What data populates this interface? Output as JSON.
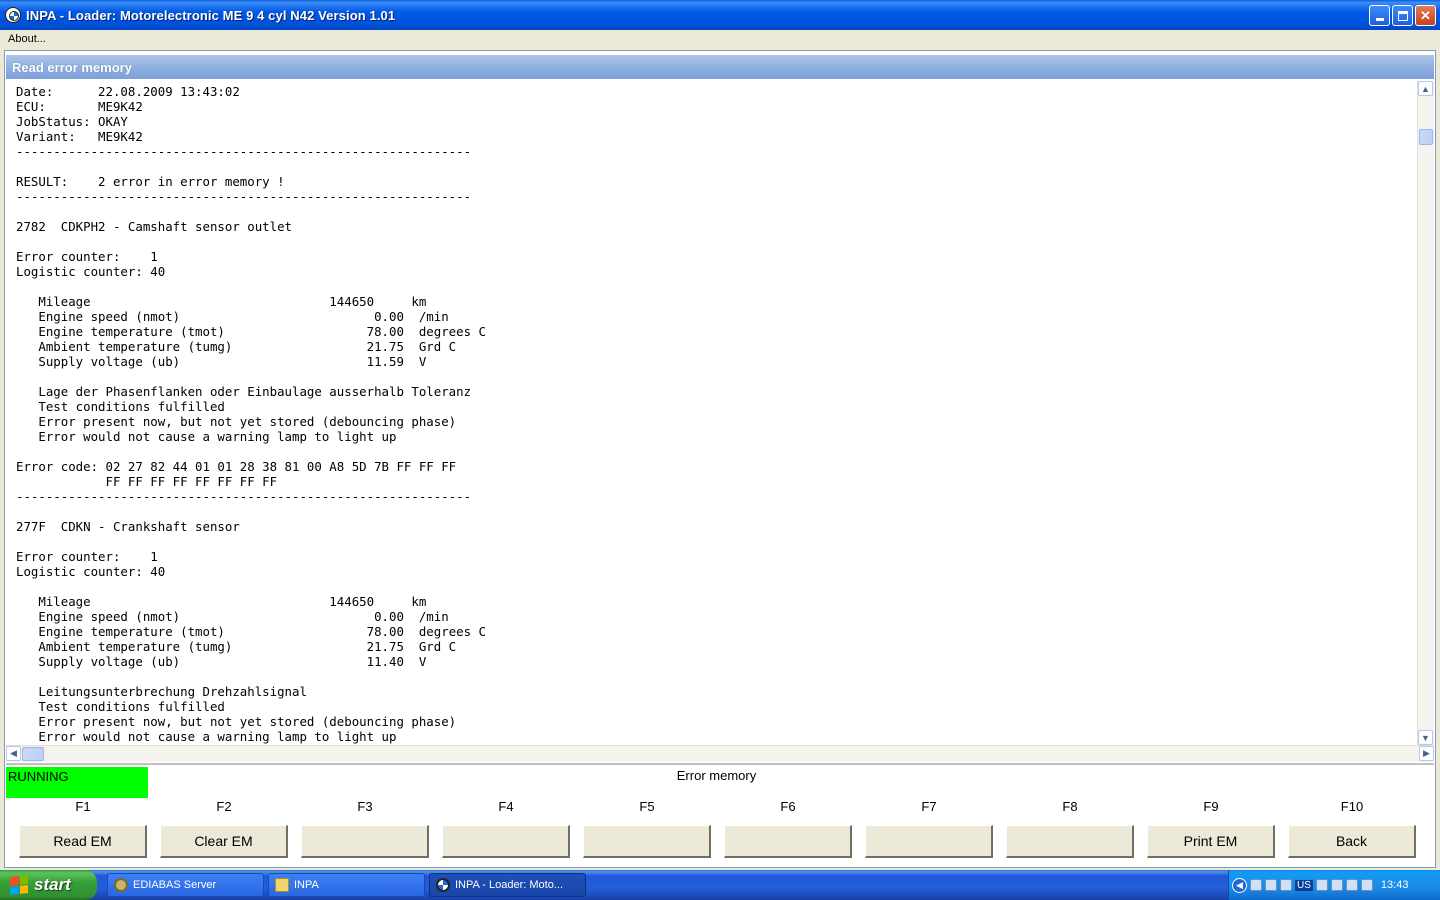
{
  "window": {
    "title": "INPA - Loader:  Motorelectronic ME 9  4 cyl N42 Version 1.01"
  },
  "menu": {
    "about": "About..."
  },
  "panel": {
    "title": "Read error memory",
    "report_lines": [
      "Date:      22.08.2009 13:43:02",
      "ECU:       ME9K42",
      "JobStatus: OKAY",
      "Variant:   ME9K42",
      "-------------------------------------------------------------",
      "",
      "RESULT:    2 error in error memory !",
      "-------------------------------------------------------------",
      "",
      "2782  CDKPH2 - Camshaft sensor outlet",
      "",
      "Error counter:    1",
      "Logistic counter: 40",
      "",
      "   Mileage                                144650     km",
      "   Engine speed (nmot)                          0.00  /min",
      "   Engine temperature (tmot)                   78.00  degrees C",
      "   Ambient temperature (tumg)                  21.75  Grd C",
      "   Supply voltage (ub)                         11.59  V",
      "",
      "   Lage der Phasenflanken oder Einbaulage ausserhalb Toleranz",
      "   Test conditions fulfilled",
      "   Error present now, but not yet stored (debouncing phase)",
      "   Error would not cause a warning lamp to light up",
      "",
      "Error code: 02 27 82 44 01 01 28 38 81 00 A8 5D 7B FF FF FF",
      "            FF FF FF FF FF FF FF FF",
      "-------------------------------------------------------------",
      "",
      "277F  CDKN - Crankshaft sensor",
      "",
      "Error counter:    1",
      "Logistic counter: 40",
      "",
      "   Mileage                                144650     km",
      "   Engine speed (nmot)                          0.00  /min",
      "   Engine temperature (tmot)                   78.00  degrees C",
      "   Ambient temperature (tumg)                  21.75  Grd C",
      "   Supply voltage (ub)                         11.40  V",
      "",
      "   Leitungsunterbrechung Drehzahlsignal",
      "   Test conditions fulfilled",
      "   Error present now, but not yet stored (debouncing phase)",
      "   Error would not cause a warning lamp to light up"
    ]
  },
  "status": {
    "state": "RUNNING",
    "state_color": "#00ff00",
    "screen_title": "Error memory"
  },
  "function_keys": [
    {
      "key": "F1",
      "label": "Read EM"
    },
    {
      "key": "F2",
      "label": "Clear EM"
    },
    {
      "key": "F3",
      "label": ""
    },
    {
      "key": "F4",
      "label": ""
    },
    {
      "key": "F5",
      "label": ""
    },
    {
      "key": "F6",
      "label": ""
    },
    {
      "key": "F7",
      "label": ""
    },
    {
      "key": "F8",
      "label": ""
    },
    {
      "key": "F9",
      "label": "Print EM"
    },
    {
      "key": "F10",
      "label": "Back"
    }
  ],
  "taskbar": {
    "start_label": "start",
    "tasks": [
      {
        "label": "EDIABAS Server",
        "icon": "gear-icon"
      },
      {
        "label": "INPA",
        "icon": "folder-icon"
      },
      {
        "label": "INPA - Loader:  Moto...",
        "icon": "bmw-icon"
      }
    ],
    "language": "US",
    "clock": "13:43"
  }
}
